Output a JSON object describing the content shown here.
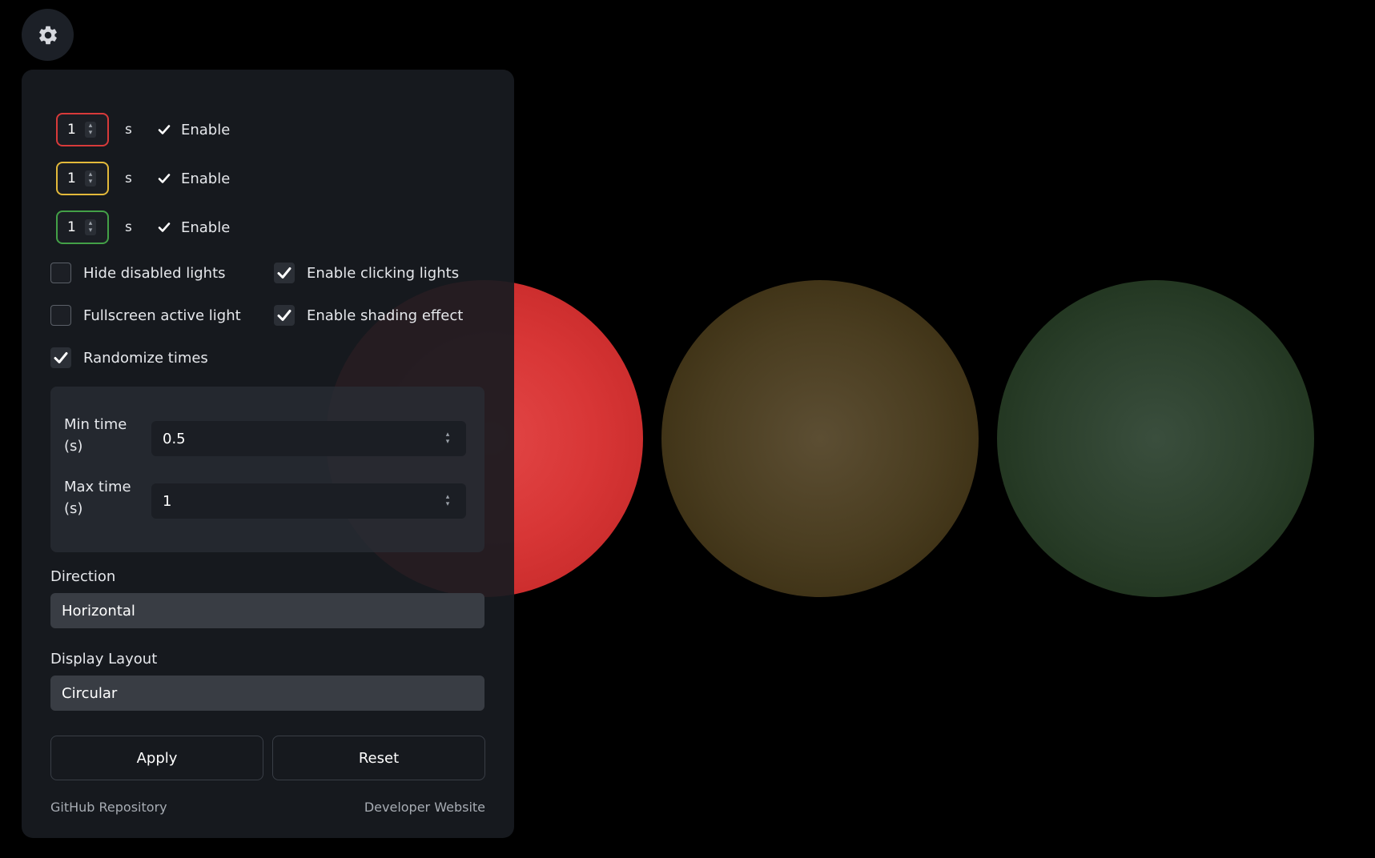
{
  "lights": [
    {
      "name": "red",
      "active": true,
      "color": "#d83636"
    },
    {
      "name": "yellow",
      "active": false,
      "color": "#4a3d20"
    },
    {
      "name": "green",
      "active": false,
      "color": "#2b3f2b"
    }
  ],
  "settings_button": {
    "icon": "gear-icon"
  },
  "timers": [
    {
      "color": "red",
      "value": "1",
      "unit": "s",
      "enable_label": "Enable",
      "enabled": true
    },
    {
      "color": "yellow",
      "value": "1",
      "unit": "s",
      "enable_label": "Enable",
      "enabled": true
    },
    {
      "color": "green",
      "value": "1",
      "unit": "s",
      "enable_label": "Enable",
      "enabled": true
    }
  ],
  "options": {
    "hide_disabled": {
      "label": "Hide disabled lights",
      "checked": false
    },
    "enable_clicking": {
      "label": "Enable clicking lights",
      "checked": true
    },
    "fullscreen_active": {
      "label": "Fullscreen active light",
      "checked": false
    },
    "enable_shading": {
      "label": "Enable shading effect",
      "checked": true
    },
    "randomize_times": {
      "label": "Randomize times",
      "checked": true
    }
  },
  "randomize": {
    "min_label_1": "Min time",
    "min_label_2": "(s)",
    "min_value": "0.5",
    "max_label_1": "Max time",
    "max_label_2": "(s)",
    "max_value": "1"
  },
  "direction": {
    "label": "Direction",
    "value": "Horizontal"
  },
  "layout": {
    "label": "Display Layout",
    "value": "Circular"
  },
  "buttons": {
    "apply": "Apply",
    "reset": "Reset"
  },
  "footer": {
    "github": "GitHub Repository",
    "developer": "Developer Website"
  }
}
